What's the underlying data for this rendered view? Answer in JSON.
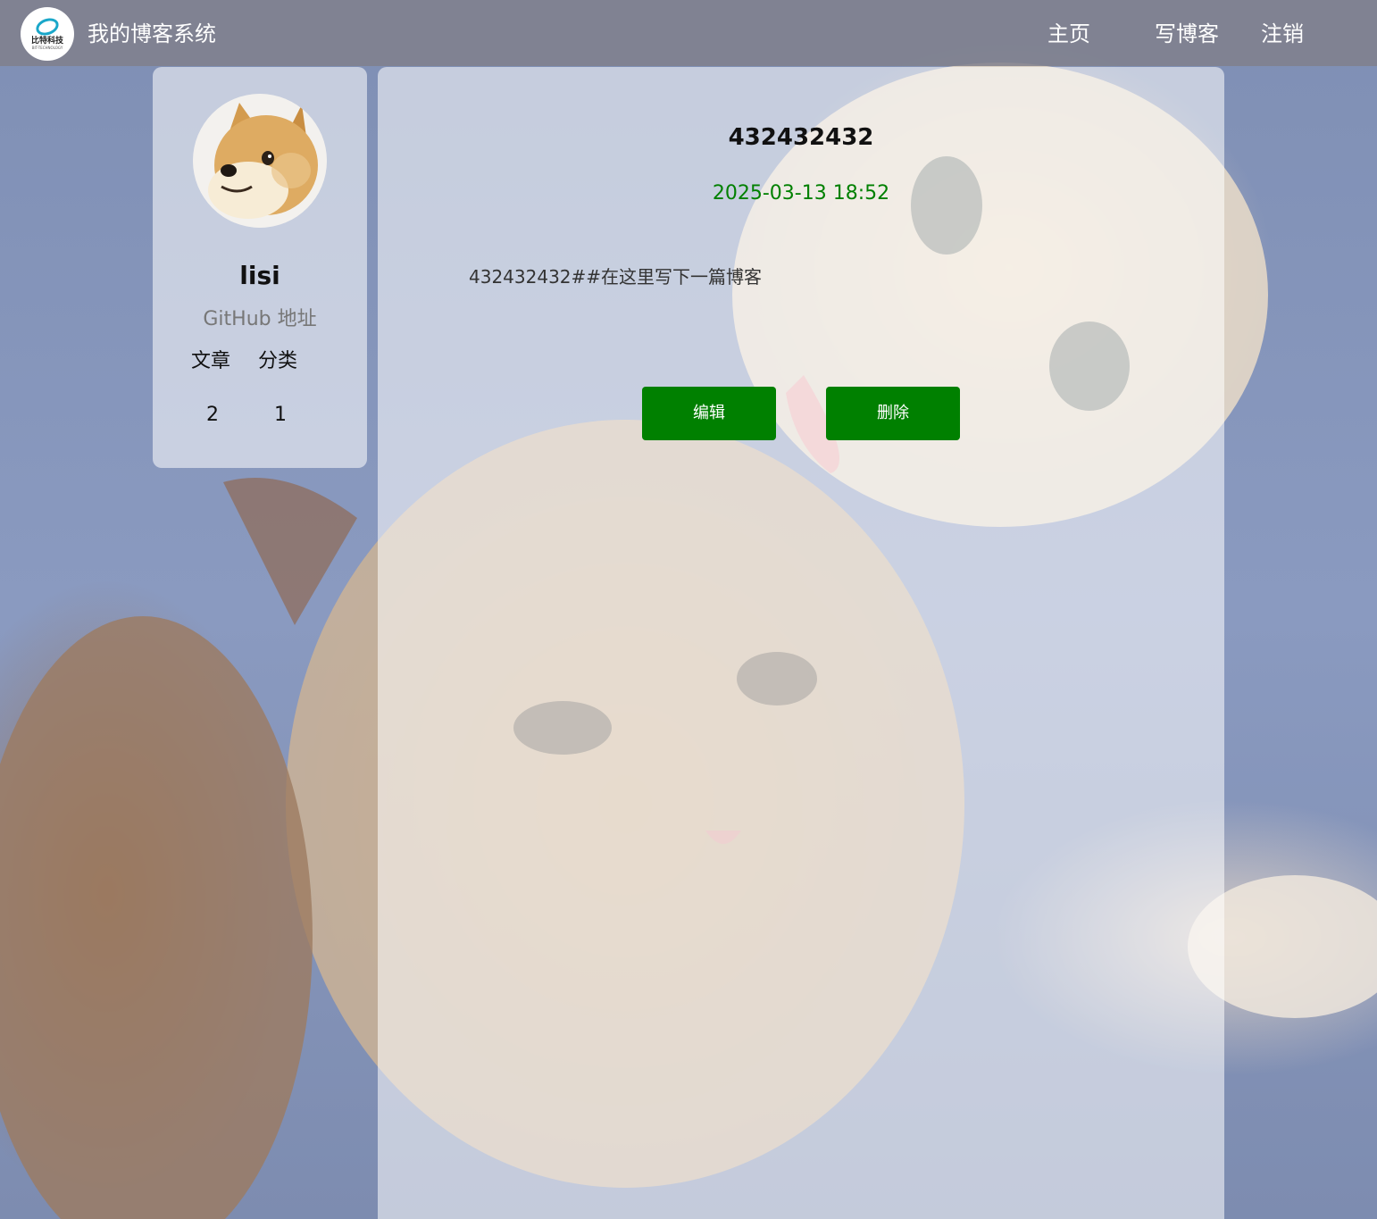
{
  "header": {
    "logo_text": "比特科技",
    "logo_subtext": "BIT-TECHNOLOGY",
    "site_title": "我的博客系统",
    "nav": {
      "home": "主页",
      "write": "写博客",
      "logout": "注销"
    }
  },
  "user": {
    "name": "lisi",
    "github_label": "GitHub 地址",
    "stats": {
      "articles_label": "文章",
      "categories_label": "分类",
      "articles_count": "2",
      "categories_count": "1"
    }
  },
  "article": {
    "title": "432432432",
    "date": "2025-03-13 18:52",
    "content": "432432432##在这里写下一篇博客"
  },
  "actions": {
    "edit_label": "编辑",
    "delete_label": "删除"
  },
  "colors": {
    "accent": "#008000",
    "date": "#008000"
  },
  "icons": {
    "logo": "bit-technology-logo",
    "avatar": "shiba-inu-avatar"
  }
}
